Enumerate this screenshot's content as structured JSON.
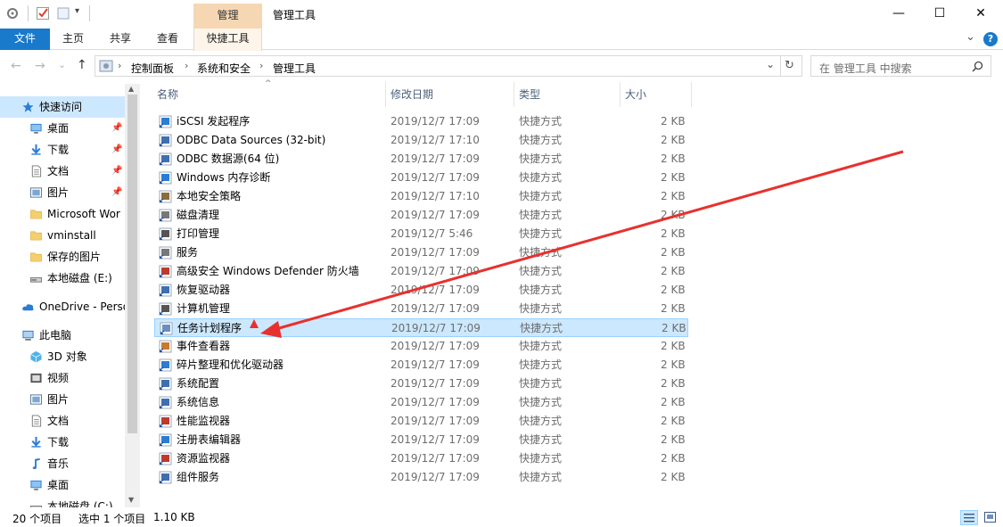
{
  "window": {
    "contextual_tab_header": "管理",
    "title": "管理工具",
    "minimize": "—",
    "maximize": "☐",
    "close": "✕"
  },
  "ribbon": {
    "tabs": [
      "文件",
      "主页",
      "共享",
      "查看",
      "快捷工具"
    ],
    "collapse_glyph": "⌄",
    "help_glyph": "?"
  },
  "address": {
    "back": "←",
    "forward": "→",
    "recent": "⌄",
    "up": "↑",
    "crumbs": [
      "控制面板",
      "系统和安全",
      "管理工具"
    ],
    "separator": "›",
    "dropdown": "⌄",
    "refresh": "↻"
  },
  "search": {
    "placeholder": "在 管理工具 中搜索",
    "icon": "search-icon"
  },
  "nav": {
    "items": [
      {
        "label": "快速访问",
        "icon": "star-icon",
        "pinned": false
      },
      {
        "label": "桌面",
        "icon": "desktop-icon",
        "pinned": true
      },
      {
        "label": "下载",
        "icon": "download-icon",
        "pinned": true
      },
      {
        "label": "文档",
        "icon": "document-icon",
        "pinned": true
      },
      {
        "label": "图片",
        "icon": "pictures-icon",
        "pinned": true
      },
      {
        "label": "Microsoft Wor",
        "icon": "folder-icon",
        "pinned": false
      },
      {
        "label": "vminstall",
        "icon": "folder-icon",
        "pinned": false
      },
      {
        "label": "保存的图片",
        "icon": "folder-icon",
        "pinned": false
      },
      {
        "label": "本地磁盘 (E:)",
        "icon": "drive-icon",
        "pinned": false
      },
      {
        "label": "OneDrive - Perso",
        "icon": "cloud-icon",
        "pinned": false
      },
      {
        "label": "此电脑",
        "icon": "computer-icon",
        "pinned": false
      },
      {
        "label": "3D 对象",
        "icon": "cube-icon",
        "pinned": false
      },
      {
        "label": "视频",
        "icon": "video-icon",
        "pinned": false
      },
      {
        "label": "图片",
        "icon": "pictures-icon",
        "pinned": false
      },
      {
        "label": "文档",
        "icon": "document-icon",
        "pinned": false
      },
      {
        "label": "下载",
        "icon": "download-icon",
        "pinned": false
      },
      {
        "label": "音乐",
        "icon": "music-icon",
        "pinned": false
      },
      {
        "label": "桌面",
        "icon": "desktop-icon",
        "pinned": false
      },
      {
        "label": "本地磁盘 (C:)",
        "icon": "drive-icon",
        "pinned": false
      }
    ],
    "pin_glyph": "📌"
  },
  "columns": {
    "name": "名称",
    "date": "修改日期",
    "type": "类型",
    "size": "大小",
    "sort_glyph": "^"
  },
  "files": [
    {
      "name": "iSCSI 发起程序",
      "date": "2019/12/7 17:09",
      "type": "快捷方式",
      "size": "2 KB"
    },
    {
      "name": "ODBC Data Sources (32-bit)",
      "date": "2019/12/7 17:10",
      "type": "快捷方式",
      "size": "2 KB"
    },
    {
      "name": "ODBC 数据源(64 位)",
      "date": "2019/12/7 17:09",
      "type": "快捷方式",
      "size": "2 KB"
    },
    {
      "name": "Windows 内存诊断",
      "date": "2019/12/7 17:09",
      "type": "快捷方式",
      "size": "2 KB"
    },
    {
      "name": "本地安全策略",
      "date": "2019/12/7 17:10",
      "type": "快捷方式",
      "size": "2 KB"
    },
    {
      "name": "磁盘清理",
      "date": "2019/12/7 17:09",
      "type": "快捷方式",
      "size": "2 KB"
    },
    {
      "name": "打印管理",
      "date": "2019/12/7 5:46",
      "type": "快捷方式",
      "size": "2 KB"
    },
    {
      "name": "服务",
      "date": "2019/12/7 17:09",
      "type": "快捷方式",
      "size": "2 KB"
    },
    {
      "name": "高级安全 Windows Defender 防火墙",
      "date": "2019/12/7 17:09",
      "type": "快捷方式",
      "size": "2 KB"
    },
    {
      "name": "恢复驱动器",
      "date": "2019/12/7 17:09",
      "type": "快捷方式",
      "size": "2 KB"
    },
    {
      "name": "计算机管理",
      "date": "2019/12/7 17:09",
      "type": "快捷方式",
      "size": "2 KB"
    },
    {
      "name": "任务计划程序",
      "date": "2019/12/7 17:09",
      "type": "快捷方式",
      "size": "2 KB",
      "selected": true
    },
    {
      "name": "事件查看器",
      "date": "2019/12/7 17:09",
      "type": "快捷方式",
      "size": "2 KB"
    },
    {
      "name": "碎片整理和优化驱动器",
      "date": "2019/12/7 17:09",
      "type": "快捷方式",
      "size": "2 KB"
    },
    {
      "name": "系统配置",
      "date": "2019/12/7 17:09",
      "type": "快捷方式",
      "size": "2 KB"
    },
    {
      "name": "系统信息",
      "date": "2019/12/7 17:09",
      "type": "快捷方式",
      "size": "2 KB"
    },
    {
      "name": "性能监视器",
      "date": "2019/12/7 17:09",
      "type": "快捷方式",
      "size": "2 KB"
    },
    {
      "name": "注册表编辑器",
      "date": "2019/12/7 17:09",
      "type": "快捷方式",
      "size": "2 KB"
    },
    {
      "name": "资源监视器",
      "date": "2019/12/7 17:09",
      "type": "快捷方式",
      "size": "2 KB"
    },
    {
      "name": "组件服务",
      "date": "2019/12/7 17:09",
      "type": "快捷方式",
      "size": "2 KB"
    }
  ],
  "status": {
    "count": "20 个项目",
    "selection": "选中 1 个项目",
    "size": "1.10 KB"
  },
  "colors": {
    "accent": "#1979ca",
    "selection": "#cce8ff",
    "annotation": "#e8312e"
  }
}
